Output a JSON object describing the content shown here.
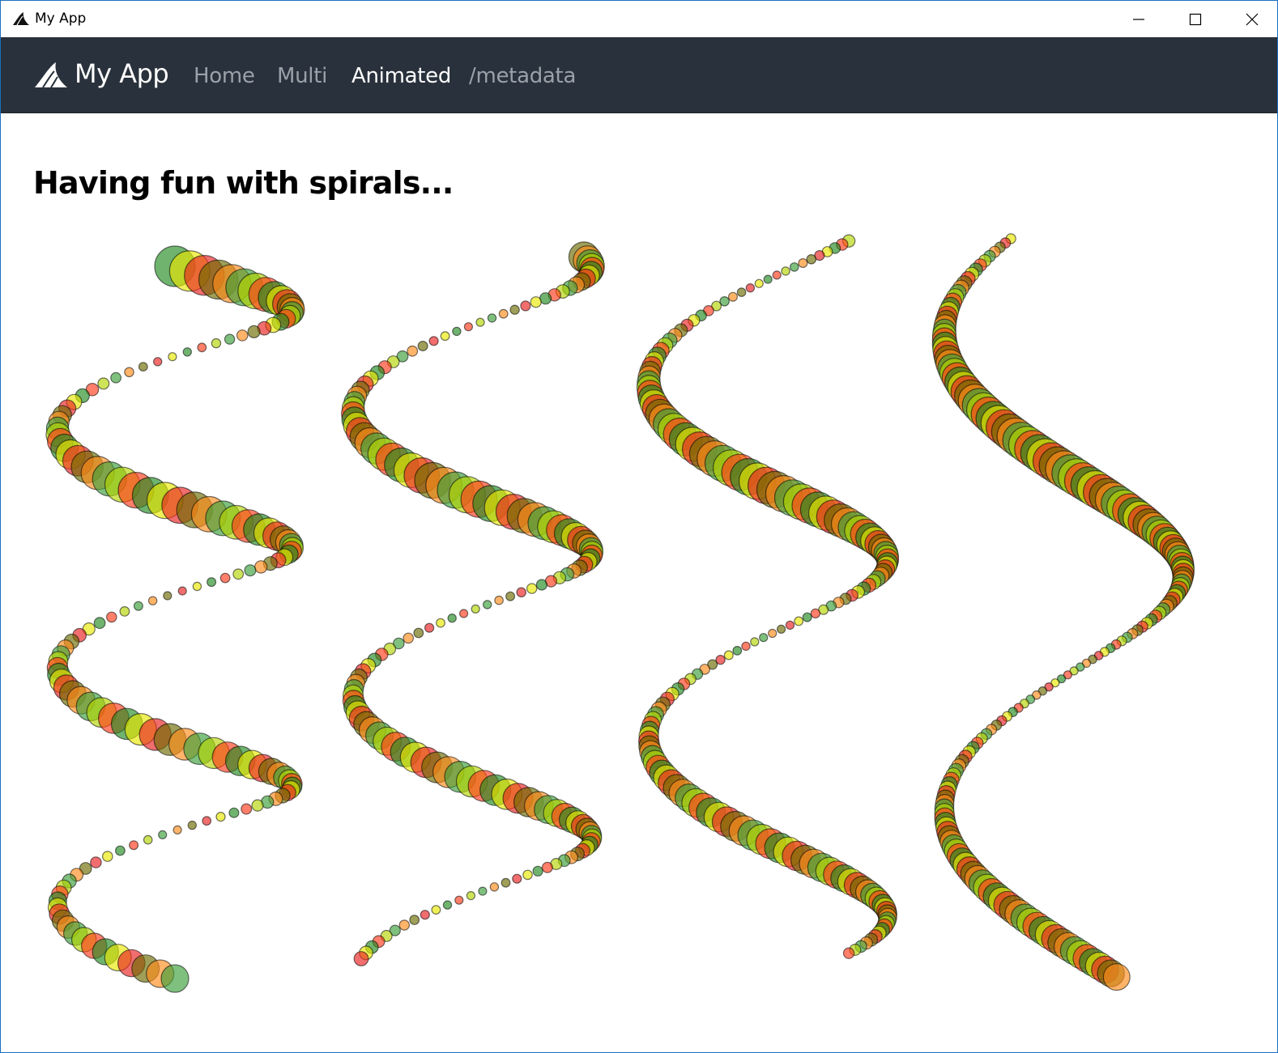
{
  "window": {
    "title": "My App",
    "icon": "shark-fin-icon",
    "controls": {
      "minimize": "minimize-icon",
      "maximize": "maximize-icon",
      "close": "close-icon"
    }
  },
  "navbar": {
    "brand": "My App",
    "brand_icon": "shark-fin-icon",
    "links": [
      {
        "label": "Home",
        "active": false
      },
      {
        "label": "Multi",
        "active": false
      },
      {
        "label": "Animated",
        "active": true
      },
      {
        "label": "/metadata",
        "active": false
      }
    ],
    "background": "#29313c"
  },
  "main": {
    "heading": "Having fun with spirals..."
  },
  "palette": [
    "#228b22",
    "#6b6b00",
    "#b3d400",
    "#e8e800",
    "#ff8c1a",
    "#ff3b1a",
    "#e82020",
    "#3a9e3a"
  ],
  "chart_data": {
    "type": "scatter",
    "title": "",
    "xlabel": "",
    "ylabel": "",
    "panels": [
      {
        "turns": 3.0,
        "phase": 0.0,
        "points": 150,
        "description_free": true
      },
      {
        "turns": 2.5,
        "phase": 1.2,
        "points": 160,
        "description_free": true
      },
      {
        "turns": 2.0,
        "phase": 2.4,
        "points": 170,
        "description_free": true
      },
      {
        "turns": 1.5,
        "phase": 3.6,
        "points": 180,
        "description_free": true
      }
    ]
  }
}
